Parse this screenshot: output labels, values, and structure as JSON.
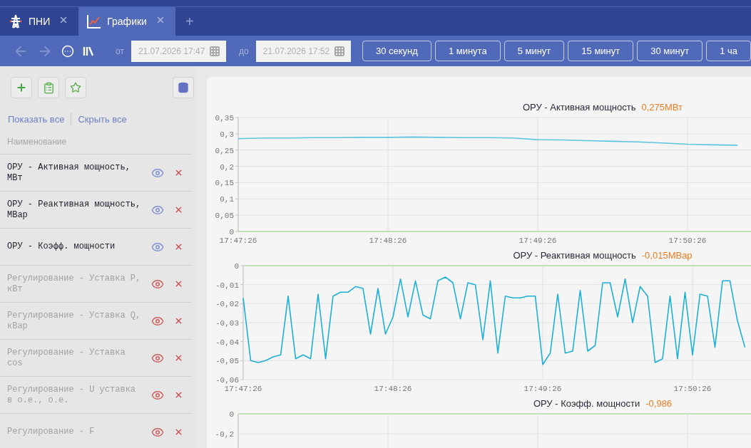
{
  "tabs": [
    {
      "label": "ПНИ",
      "selected": false
    },
    {
      "label": "Графики",
      "selected": true
    }
  ],
  "new_tab": "+",
  "toolbar": {
    "from_label": "от",
    "from_value": "21.07.2026 17:47",
    "to_label": "до",
    "to_value": "21.07.2026 17:52",
    "ranges": [
      "30 секунд",
      "1 минута",
      "5 минут",
      "15 минут",
      "30 минут",
      "1 ча"
    ]
  },
  "sidebar": {
    "show_all": "Показать все",
    "hide_all": "Скрыть все",
    "column": "Наименование",
    "items": [
      {
        "name": "ОРУ - Активная мощность, МВт",
        "visible": true
      },
      {
        "name": "ОРУ - Реактивная мощность, МВар",
        "visible": true
      },
      {
        "name": "ОРУ - Коэфф. мощности",
        "visible": true
      },
      {
        "name": "Регулирование - Уставка P, кВт",
        "visible": false
      },
      {
        "name": "Регулирование - Уставка Q, кВар",
        "visible": false
      },
      {
        "name": "Регулирование - Уставка cos",
        "visible": false
      },
      {
        "name": "Регулирование - U уставка в о.е., о.е.",
        "visible": false
      },
      {
        "name": "Регулирование - F",
        "visible": false
      }
    ]
  },
  "charts": [
    {
      "current_value": "0,275МВт",
      "chart_data": {
        "type": "line",
        "title": "ОРУ - Активная мощность",
        "categories": [
          "17:47:26",
          null,
          null,
          null,
          null,
          null,
          "17:48:26",
          null,
          null,
          null,
          null,
          null,
          "17:49:26",
          null,
          null,
          null,
          null,
          null,
          "17:50:26",
          null,
          null
        ],
        "series": [
          {
            "color": "#5cc6e0",
            "values": [
              0.285,
              0.287,
              0.287,
              0.288,
              0.288,
              0.289,
              0.289,
              0.29,
              0.289,
              0.288,
              0.288,
              0.287,
              0.282,
              0.281,
              0.279,
              0.277,
              0.275,
              0.272,
              0.268,
              0.266,
              0.265
            ]
          }
        ],
        "ylim": [
          0,
          0.35
        ],
        "grid": true,
        "yticks": [
          {
            "value": 0,
            "label": "0"
          },
          {
            "value": 0.05,
            "label": "0,05"
          },
          {
            "value": 0.1,
            "label": "0,1"
          },
          {
            "value": 0.15,
            "label": "0,15"
          },
          {
            "value": 0.2,
            "label": "0,2"
          },
          {
            "value": 0.25,
            "label": "0,25"
          },
          {
            "value": 0.3,
            "label": "0,3"
          },
          {
            "value": 0.35,
            "label": "0,35"
          }
        ]
      }
    },
    {
      "current_value": "-0,015МВар",
      "chart_data": {
        "type": "line",
        "title": "ОРУ - Реактивная мощность",
        "categories": [
          "17:47:26",
          null,
          null,
          null,
          null,
          null,
          null,
          null,
          null,
          null,
          null,
          null,
          null,
          null,
          null,
          null,
          null,
          null,
          null,
          null,
          "17:48:26",
          null,
          null,
          null,
          null,
          null,
          null,
          null,
          null,
          null,
          null,
          null,
          null,
          null,
          null,
          null,
          null,
          null,
          null,
          null,
          "17:49:26",
          null,
          null,
          null,
          null,
          null,
          null,
          null,
          null,
          null,
          null,
          null,
          null,
          null,
          null,
          null,
          null,
          null,
          null,
          null,
          "17:50:26",
          null,
          null,
          null,
          null,
          null,
          null,
          null
        ],
        "series": [
          {
            "color": "#1fb0d6",
            "values": [
              -0.017,
              -0.05,
              -0.051,
              -0.05,
              -0.048,
              -0.047,
              -0.016,
              -0.049,
              -0.047,
              -0.049,
              -0.015,
              -0.049,
              -0.016,
              -0.014,
              -0.014,
              -0.011,
              -0.012,
              -0.036,
              -0.012,
              -0.036,
              -0.027,
              -0.007,
              -0.027,
              -0.008,
              -0.026,
              -0.028,
              -0.008,
              -0.006,
              -0.009,
              -0.028,
              -0.009,
              -0.01,
              -0.039,
              -0.008,
              -0.046,
              -0.016,
              -0.017,
              -0.017,
              -0.016,
              -0.016,
              -0.052,
              -0.046,
              -0.015,
              -0.046,
              -0.045,
              -0.013,
              -0.045,
              -0.042,
              -0.009,
              -0.009,
              -0.027,
              -0.007,
              -0.03,
              -0.011,
              -0.016,
              -0.051,
              -0.049,
              -0.016,
              -0.049,
              -0.014,
              -0.047,
              -0.015,
              -0.016,
              -0.043,
              -0.008,
              -0.008,
              -0.029,
              -0.043
            ]
          }
        ],
        "ylim": [
          -0.06,
          0
        ],
        "grid": true,
        "yticks": [
          {
            "value": 0,
            "label": "0"
          },
          {
            "value": -0.01,
            "label": "-0,01"
          },
          {
            "value": -0.02,
            "label": "-0,02"
          },
          {
            "value": -0.03,
            "label": "-0,03"
          },
          {
            "value": -0.04,
            "label": "-0,04"
          },
          {
            "value": -0.05,
            "label": "-0,05"
          },
          {
            "value": -0.06,
            "label": "-0,06"
          }
        ]
      }
    },
    {
      "title": "ОРУ - Коэфф. мощности",
      "current_value": "-0,986",
      "y_labels": [
        "0",
        "-0,2"
      ]
    }
  ]
}
